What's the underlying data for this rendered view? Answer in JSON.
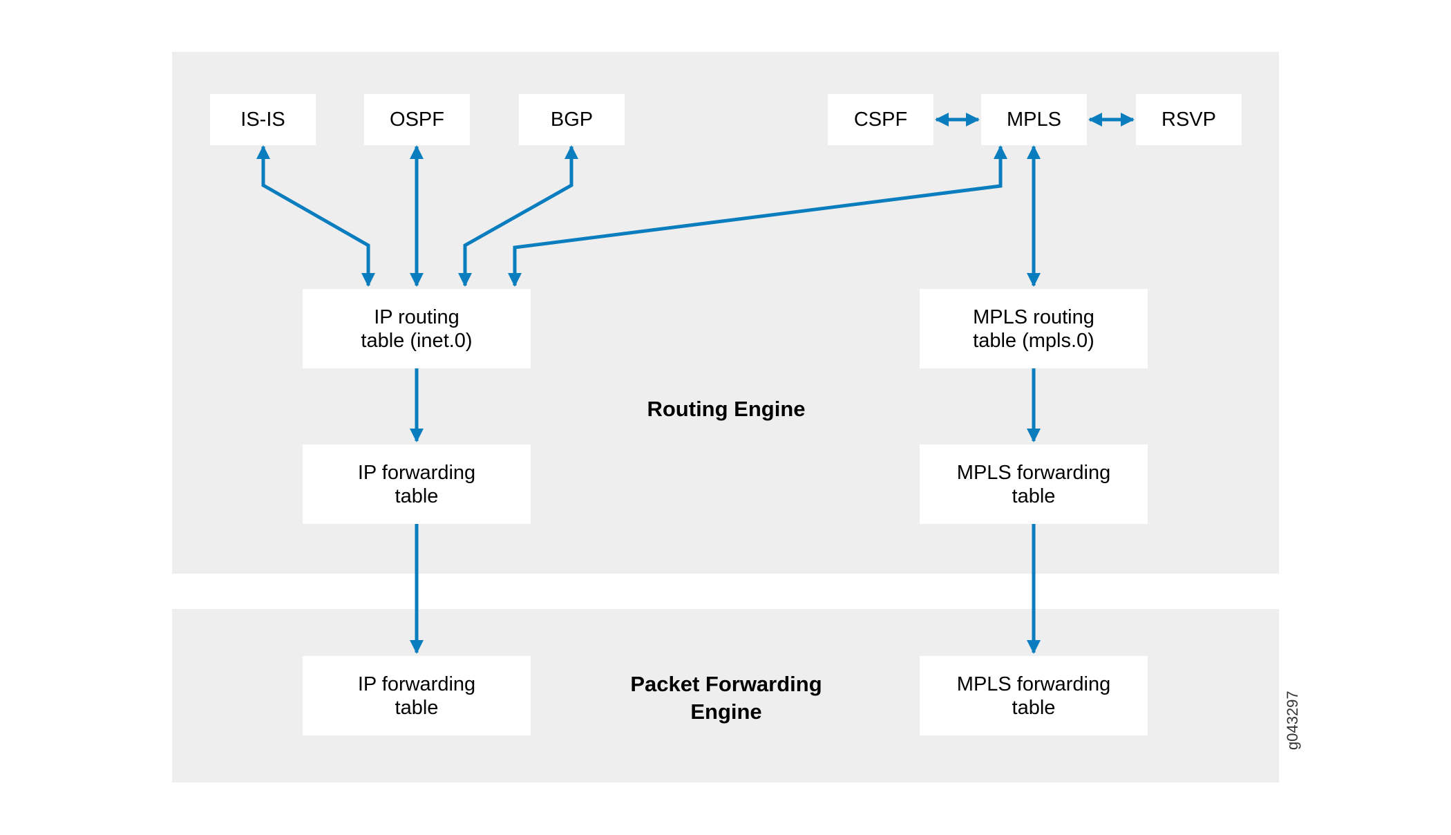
{
  "panels": {
    "routing_engine": "Routing Engine",
    "packet_forwarding_engine": "Packet Forwarding\nEngine"
  },
  "protocols": [
    "IS-IS",
    "OSPF",
    "BGP",
    "CSPF",
    "MPLS",
    "RSVP"
  ],
  "tables": {
    "ip_routing": "IP routing\ntable (inet.0)",
    "mpls_routing": "MPLS routing\ntable (mpls.0)",
    "ip_forwarding_re": "IP forwarding\ntable",
    "mpls_forwarding_re": "MPLS forwarding\ntable",
    "ip_forwarding_pfe": "IP forwarding\ntable",
    "mpls_forwarding_pfe": "MPLS forwarding\ntable"
  },
  "figure_id": "g043297",
  "colors": {
    "arrow": "#0a7dbf",
    "panel": "#eeeeee",
    "box": "#ffffff"
  }
}
